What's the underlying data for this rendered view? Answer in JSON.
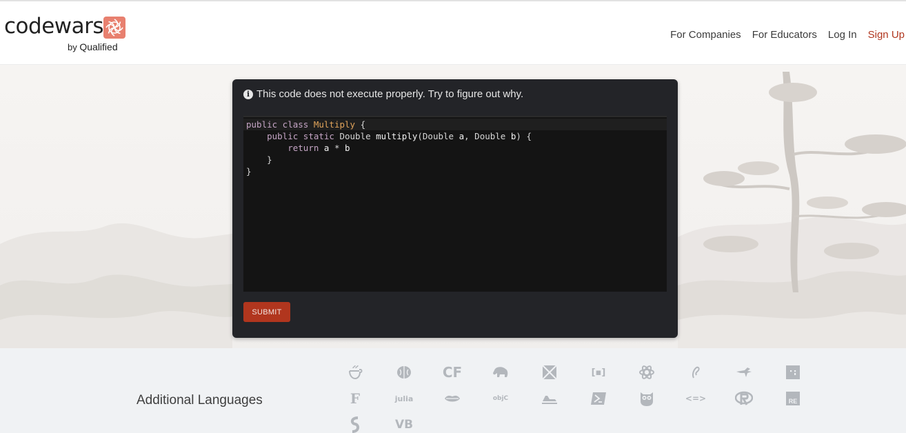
{
  "header": {
    "logo_word": "codewars",
    "logo_sub_prefix": "by",
    "logo_sub_brand": "Qualified",
    "nav": [
      {
        "label": "For Companies"
      },
      {
        "label": "For Educators"
      },
      {
        "label": "Log In"
      },
      {
        "label": "Sign Up"
      }
    ]
  },
  "kata": {
    "message": "This code does not execute properly. Try to figure out why.",
    "code_lines": [
      "public class Multiply {",
      "    public static Double multiply(Double a, Double b) {",
      "        return a * b",
      "    }",
      "}"
    ],
    "submit_label": "SUBMIT"
  },
  "languages": {
    "title": "Additional Languages",
    "icons": [
      {
        "name": "coffeescript-icon",
        "glyph": ""
      },
      {
        "name": "brain-icon",
        "glyph": ""
      },
      {
        "name": "cfml-icon",
        "glyph": "CF"
      },
      {
        "name": "elephant-icon",
        "glyph": ""
      },
      {
        "name": "box-icon",
        "glyph": ""
      },
      {
        "name": "brackets-icon",
        "glyph": "[▪]"
      },
      {
        "name": "atom-icon",
        "glyph": ""
      },
      {
        "name": "forth-icon",
        "glyph": ""
      },
      {
        "name": "dinosaur-icon",
        "glyph": ""
      },
      {
        "name": "factor-icon",
        "glyph": ":;"
      },
      {
        "name": "fsharp-icon",
        "glyph": "F"
      },
      {
        "name": "julia-icon",
        "glyph": "julia"
      },
      {
        "name": "lips-icon",
        "glyph": ""
      },
      {
        "name": "objc-icon",
        "glyph": "objC"
      },
      {
        "name": "lambda-car-icon",
        "glyph": ""
      },
      {
        "name": "powershell-icon",
        "glyph": ""
      },
      {
        "name": "owl-icon",
        "glyph": ""
      },
      {
        "name": "arrows-icon",
        "glyph": "<=>"
      },
      {
        "name": "r-icon",
        "glyph": "R"
      },
      {
        "name": "re-icon",
        "glyph": "RE"
      },
      {
        "name": "swift-icon",
        "glyph": "S"
      },
      {
        "name": "vb-icon",
        "glyph": "VB"
      }
    ]
  },
  "colors": {
    "brand": "#b1361e",
    "logo_mark": "#e8806f",
    "card_bg": "#232428",
    "editor_bg": "#141414"
  }
}
